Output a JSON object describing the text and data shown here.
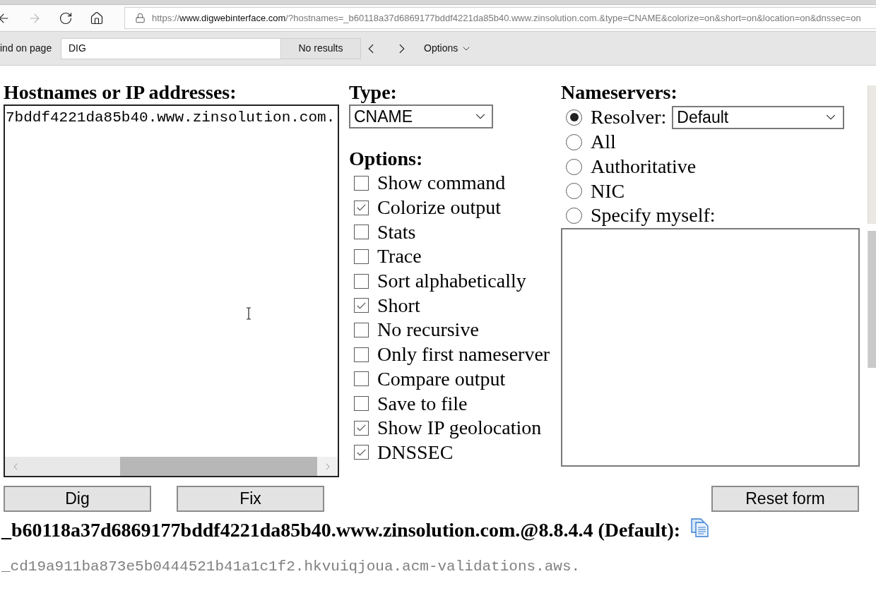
{
  "browser": {
    "nav_buttons": [
      {
        "kind": "back",
        "disabled": false
      },
      {
        "kind": "forward",
        "disabled": true
      },
      {
        "kind": "refresh",
        "disabled": false
      },
      {
        "kind": "home",
        "disabled": false
      }
    ],
    "address_bar": {
      "scheme": "https://",
      "host": "www.digwebinterface.com",
      "path": "/?hostnames=_b60118a37d6869177bddf4221da85b40.www.zinsolution.com.&type=CNAME&colorize=on&short=on&location=on&dnssec=on"
    },
    "find_bar": {
      "label": "ind on page",
      "value": "DIG",
      "status": "No results",
      "options": "Options"
    }
  },
  "form": {
    "hostnames": {
      "label": "Hostnames or IP addresses:",
      "value": "7bddf4221da85b40.www.zinsolution.com."
    },
    "type": {
      "label": "Type:",
      "value": "CNAME"
    },
    "options": {
      "label": "Options:",
      "items": [
        {
          "label": "Show command",
          "checked": false
        },
        {
          "label": "Colorize output",
          "checked": true
        },
        {
          "label": "Stats",
          "checked": false
        },
        {
          "label": "Trace",
          "checked": false
        },
        {
          "label": "Sort alphabetically",
          "checked": false
        },
        {
          "label": "Short",
          "checked": true
        },
        {
          "label": "No recursive",
          "checked": false
        },
        {
          "label": "Only first nameserver",
          "checked": false
        },
        {
          "label": "Compare output",
          "checked": false
        },
        {
          "label": "Save to file",
          "checked": false
        },
        {
          "label": "Show IP geolocation",
          "checked": true
        },
        {
          "label": "DNSSEC",
          "checked": true
        }
      ]
    },
    "nameservers": {
      "label": "Nameservers:",
      "items": [
        {
          "kind": "select",
          "label": "Resolver:",
          "selected": true,
          "value": "Default"
        },
        {
          "kind": "plain",
          "label": "All",
          "selected": false
        },
        {
          "kind": "plain",
          "label": "Authoritative",
          "selected": false
        },
        {
          "kind": "plain",
          "label": "NIC",
          "selected": false
        },
        {
          "kind": "plain",
          "label": "Specify myself:",
          "selected": false
        }
      ]
    },
    "actions": {
      "left": [
        "Dig",
        "Fix"
      ],
      "right": [
        "Reset form"
      ]
    }
  },
  "result": {
    "heading": "_b60118a37d6869177bddf4221da85b40.www.zinsolution.com.@8.8.4.4 (Default):",
    "lines": [
      "_cd19a911ba873e5b0444521b41a1c1f2.hkvuiqjoua.acm-validations.aws."
    ]
  }
}
